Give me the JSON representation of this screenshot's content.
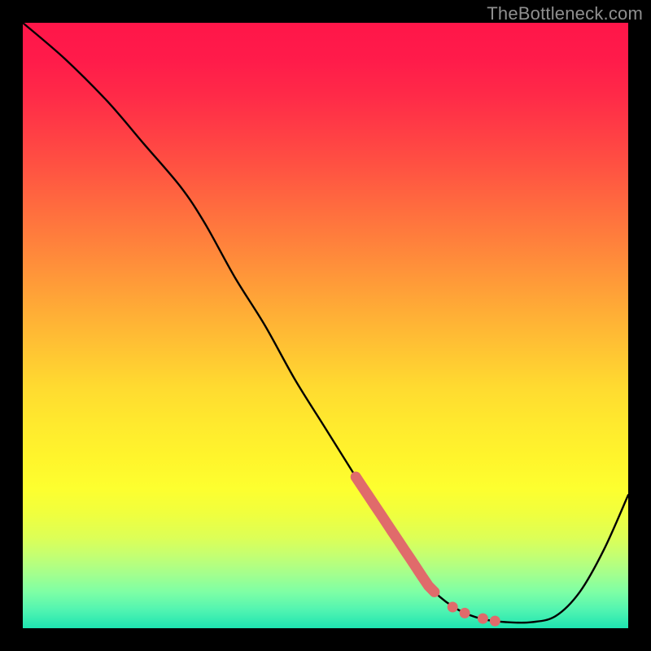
{
  "watermark": "TheBottleneck.com",
  "colors": {
    "frame_bg": "#000000",
    "curve_stroke": "#000000",
    "marker_fill": "#e06b6b",
    "marker_stroke": "#d85f5f"
  },
  "chart_data": {
    "type": "line",
    "title": "",
    "xlabel": "",
    "ylabel": "",
    "xlim": [
      0,
      100
    ],
    "ylim": [
      0,
      100
    ],
    "grid": false,
    "legend": false,
    "series": [
      {
        "name": "curve",
        "x": [
          0,
          7,
          14,
          20,
          26,
          30,
          35,
          40,
          45,
          50,
          55,
          60,
          65,
          68,
          72,
          76,
          80,
          84,
          88,
          92,
          96,
          100
        ],
        "y": [
          100,
          94,
          87,
          80,
          73,
          67,
          58,
          50,
          41,
          33,
          25,
          17,
          10,
          6,
          3,
          1.5,
          1,
          1,
          2,
          6,
          13,
          22
        ]
      }
    ],
    "markers": [
      {
        "name": "highlight-segment",
        "shape": "circle",
        "x": [
          55,
          56,
          57,
          58,
          59,
          60,
          61,
          62,
          63,
          64,
          65,
          66,
          67,
          68,
          71,
          73,
          76,
          78
        ],
        "y": [
          25,
          23.5,
          22,
          20.5,
          19,
          17.5,
          16,
          14.5,
          13,
          11.5,
          10,
          8.5,
          7,
          6,
          3.5,
          2.5,
          1.6,
          1.2
        ]
      }
    ]
  }
}
